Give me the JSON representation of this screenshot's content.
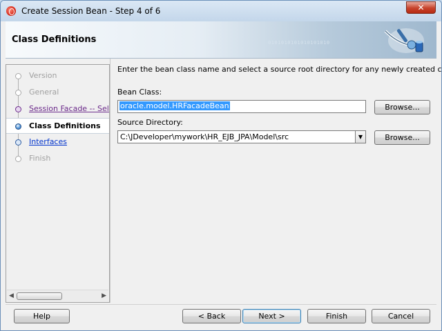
{
  "window": {
    "title": "Create Session Bean - Step 4 of 6",
    "close_glyph": "✕"
  },
  "header": {
    "title": "Class Definitions",
    "decoration_text": "0101010101010101010"
  },
  "nav": {
    "items": [
      {
        "label": "Version",
        "state": "dim"
      },
      {
        "label": "General",
        "state": "dim"
      },
      {
        "label": "Session Facade -- Select",
        "state": "done"
      },
      {
        "label": "Class Definitions",
        "state": "active"
      },
      {
        "label": "Interfaces",
        "state": "link"
      },
      {
        "label": "Finish",
        "state": "dim"
      }
    ],
    "scroll_left": "◀",
    "scroll_right": "▶"
  },
  "content": {
    "intro": "Enter the bean class name and select a source root directory for any newly created classes.",
    "bean_class_label": "Bean Class:",
    "bean_class_value": "oracle.model.HRFacadeBean",
    "source_dir_label": "Source Directory:",
    "source_dir_value": "C:\\JDeveloper\\mywork\\HR_EJB_JPA\\Model\\src",
    "browse_label": "Browse...",
    "combo_arrow": "▼"
  },
  "buttons": {
    "help": "Help",
    "back": "< Back",
    "next": "Next >",
    "finish": "Finish",
    "cancel": "Cancel"
  },
  "colors": {
    "accent_selection": "#3399ff",
    "link": "#0033cc",
    "visited_link": "#6b2a8a",
    "close_button": "#c7432c"
  }
}
